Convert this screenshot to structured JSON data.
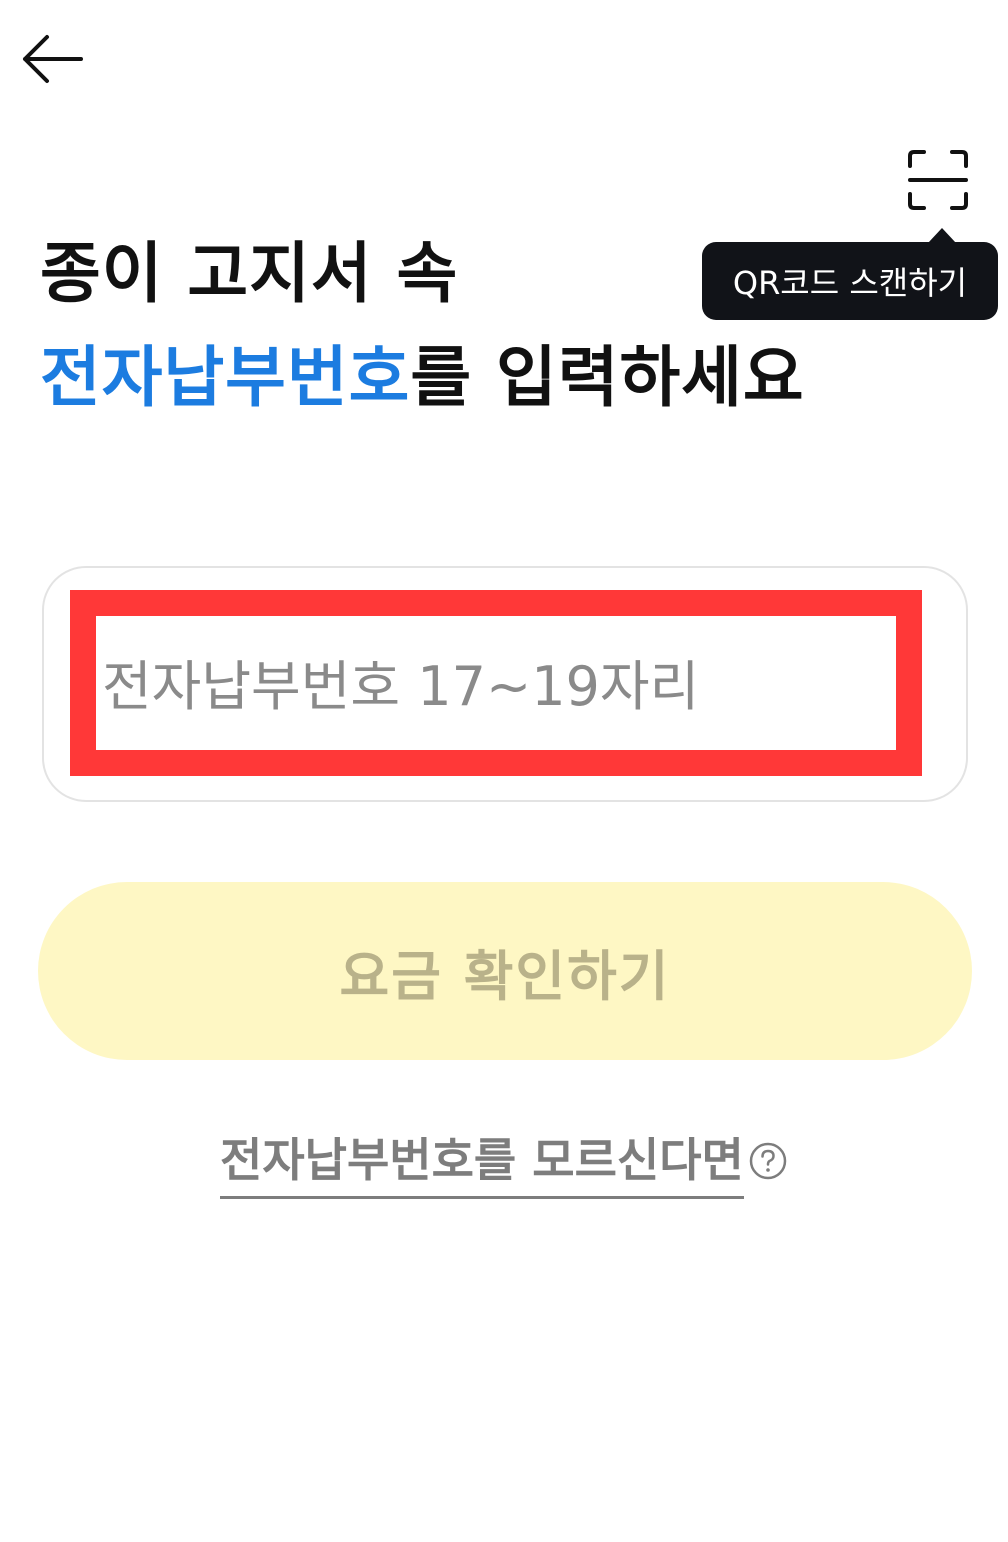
{
  "header": {
    "back_icon": "arrow-left-icon",
    "scan_icon": "qr-scan-frame-icon",
    "tooltip_text": "QR코드 스캔하기"
  },
  "headline": {
    "line1": "종이 고지서 속",
    "line2_accent": "전자납부번호",
    "line2_rest": "를 입력하세요",
    "accent_color": "#1c7ce0"
  },
  "input": {
    "value": "",
    "placeholder": "전자납부번호 17~19자리",
    "highlight_color": "#ff3838"
  },
  "confirm_button": {
    "label": "요금 확인하기",
    "background_color": "#fef7c4",
    "text_color": "#b9b28a"
  },
  "help": {
    "link_text": "전자납부번호를 모르신다면",
    "icon": "question-circle-icon"
  }
}
